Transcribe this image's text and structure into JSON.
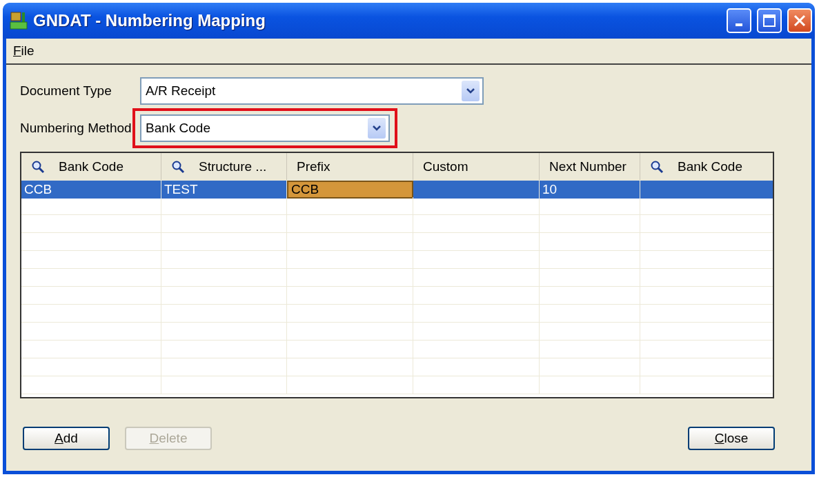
{
  "window": {
    "title": "GNDAT - Numbering Mapping"
  },
  "menu": [
    {
      "label": "File"
    }
  ],
  "fields": [
    {
      "label": "Document Type",
      "value": "A/R Receipt",
      "highlighted": false
    },
    {
      "label": "Numbering Method",
      "value": "Bank Code",
      "highlighted": true
    }
  ],
  "table": {
    "columns": [
      {
        "label": "Bank Code",
        "lookup": true
      },
      {
        "label": "Structure ...",
        "lookup": true
      },
      {
        "label": "Prefix",
        "lookup": false
      },
      {
        "label": "Custom",
        "lookup": false
      },
      {
        "label": "Next Number",
        "lookup": false
      },
      {
        "label": "Bank Code",
        "lookup": true
      }
    ],
    "rows": [
      {
        "selected": true,
        "cells": [
          {
            "text": "CCB",
            "focused": false
          },
          {
            "text": "TEST",
            "focused": false
          },
          {
            "text": "CCB",
            "focused": true
          },
          {
            "focused": false
          },
          {
            "text": "10",
            "focused": false
          },
          {
            "focused": false
          }
        ]
      }
    ]
  },
  "buttons": [
    {
      "label": "Add",
      "disabled": false
    },
    {
      "label": "Delete",
      "disabled": true
    },
    {
      "label": "Close",
      "disabled": false
    }
  ]
}
